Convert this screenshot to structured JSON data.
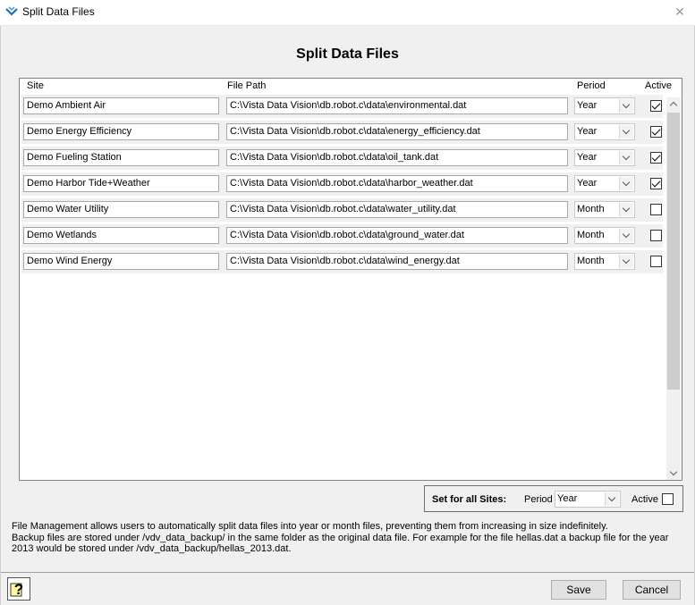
{
  "window": {
    "title": "Split Data Files",
    "icon": "vista-data-vision-icon",
    "close_icon": "close-icon"
  },
  "page_title": "Split Data Files",
  "columns": {
    "site": "Site",
    "file_path": "File Path",
    "period": "Period",
    "active": "Active"
  },
  "rows": [
    {
      "site": "Demo Ambient Air",
      "path": "C:\\Vista Data Vision\\db.robot.c\\data\\environmental.dat",
      "period": "Year",
      "active": true
    },
    {
      "site": "Demo Energy Efficiency",
      "path": "C:\\Vista Data Vision\\db.robot.c\\data\\energy_efficiency.dat",
      "period": "Year",
      "active": true
    },
    {
      "site": "Demo Fueling Station",
      "path": "C:\\Vista Data Vision\\db.robot.c\\data\\oil_tank.dat",
      "period": "Year",
      "active": true
    },
    {
      "site": "Demo Harbor Tide+Weather",
      "path": "C:\\Vista Data Vision\\db.robot.c\\data\\harbor_weather.dat",
      "period": "Year",
      "active": true
    },
    {
      "site": "Demo Water Utility",
      "path": "C:\\Vista Data Vision\\db.robot.c\\data\\water_utility.dat",
      "period": "Month",
      "active": false
    },
    {
      "site": "Demo Wetlands",
      "path": "C:\\Vista Data Vision\\db.robot.c\\data\\ground_water.dat",
      "period": "Month",
      "active": false
    },
    {
      "site": "Demo Wind Energy",
      "path": "C:\\Vista Data Vision\\db.robot.c\\data\\wind_energy.dat",
      "period": "Month",
      "active": false
    }
  ],
  "set_all": {
    "label": "Set for all Sites:",
    "period_label": "Period",
    "period_value": "Year",
    "active_label": "Active",
    "active": false
  },
  "info": {
    "line1": "File Management allows users to automatically split data files into year or month files, preventing them from increasing in size indefinitely.",
    "line2": "Backup files are stored under /vdv_data_backup/ in the same folder as the original data file.  For example for the file hellas.dat a backup file for the year 2013 would be stored under /vdv_data_backup/hellas_2013.dat."
  },
  "buttons": {
    "save": "Save",
    "cancel": "Cancel",
    "help_icon": "help-question-icon"
  },
  "colors": {
    "background": "#f0f0f0",
    "accent": "#1e6fb5"
  }
}
